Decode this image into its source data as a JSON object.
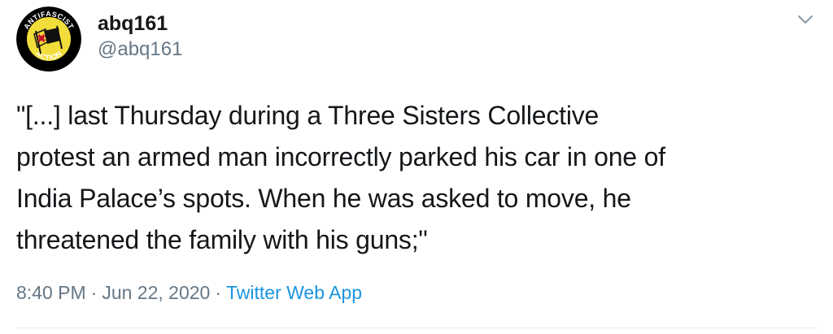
{
  "user": {
    "display_name": "abq161",
    "handle": "@abq161",
    "avatar": {
      "icon": "antifascist-action-flag-logo",
      "text_top": "ANTIFASCIST",
      "text_bottom": "ACTION",
      "colors": {
        "background": "#f2de3a",
        "ring": "#000000",
        "flag_black": "#111111",
        "flag_yellow": "#f2de3a",
        "zia_symbol": "#c8102e"
      }
    }
  },
  "menu": {
    "icon": "chevron-down-icon"
  },
  "tweet": {
    "lines": [
      "\"[...] last Thursday during a Three Sisters Collective",
      "protest an armed man incorrectly parked his car in one of",
      "India Palace’s spots. When he was asked to move, he",
      "threatened the family with his guns;\""
    ]
  },
  "meta": {
    "time": "8:40 PM",
    "separator": "·",
    "date": "Jun 22, 2020",
    "source": "Twitter Web App"
  },
  "colors": {
    "text": "#14171a",
    "secondary": "#657786",
    "link": "#1b95e0",
    "divider": "#e6ecf0"
  }
}
